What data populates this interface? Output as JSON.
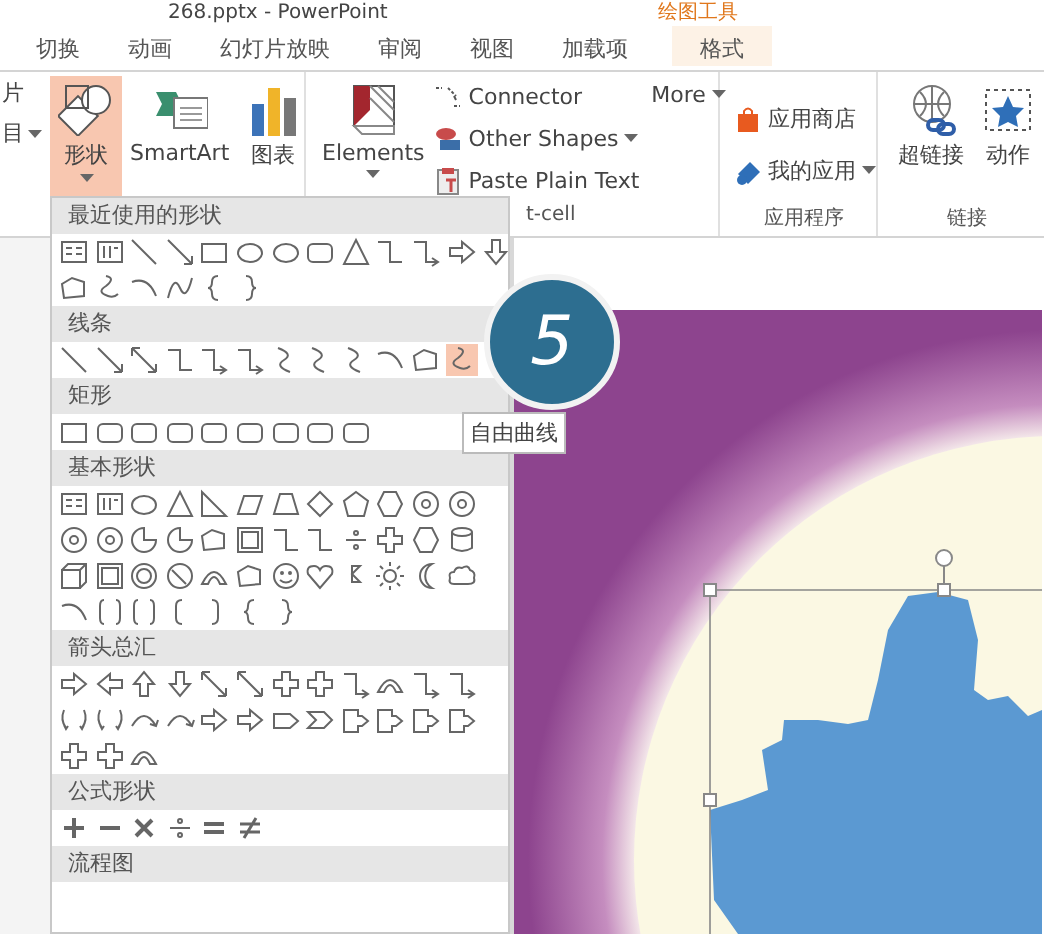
{
  "window": {
    "title": "268.pptx - PowerPoint",
    "context_title": "绘图工具"
  },
  "tabs": [
    {
      "label": "切换",
      "selected": false
    },
    {
      "label": "动画",
      "selected": false
    },
    {
      "label": "幻灯片放映",
      "selected": false
    },
    {
      "label": "审阅",
      "selected": false
    },
    {
      "label": "视图",
      "selected": false
    },
    {
      "label": "加载项",
      "selected": false
    },
    {
      "label": "格式",
      "selected": true
    }
  ],
  "ribbon": {
    "edge_labels": [
      {
        "label": "片",
        "has_menu": false
      },
      {
        "label": "目",
        "has_menu": true
      }
    ],
    "insert_group": {
      "buttons": [
        {
          "kind": "shapes",
          "label": "形状",
          "selected": true,
          "has_menu": true
        },
        {
          "kind": "smartart",
          "label": "SmartArt",
          "selected": false,
          "has_menu": false
        },
        {
          "kind": "chart",
          "label": "图表",
          "selected": false,
          "has_menu": false
        }
      ]
    },
    "addin_group": {
      "elements": {
        "label": "Elements",
        "has_menu": true
      },
      "commands": [
        {
          "kind": "connector",
          "label": "Connector",
          "has_menu": false
        },
        {
          "kind": "shapes",
          "label": "Other Shapes",
          "has_menu": true
        },
        {
          "kind": "paste",
          "label": "Paste Plain Text",
          "has_menu": false
        }
      ],
      "more": {
        "label": "More",
        "has_menu": true
      },
      "group_label": "t-cell"
    },
    "apps_group": {
      "commands": [
        {
          "kind": "store",
          "label": "应用商店",
          "has_menu": false
        },
        {
          "kind": "apps",
          "label": "我的应用",
          "has_menu": true
        }
      ],
      "group_label": "应用程序"
    },
    "links_group": {
      "buttons": [
        {
          "kind": "hyperlink",
          "label": "超链接"
        },
        {
          "kind": "action",
          "label": "动作"
        }
      ],
      "group_label": "链接"
    }
  },
  "shapes_menu": {
    "sections": [
      {
        "title": "最近使用的形状"
      },
      {
        "title": "线条",
        "shapes": [
          {
            "selected": false
          },
          {
            "selected": false
          },
          {
            "selected": false
          },
          {
            "selected": false
          },
          {
            "selected": false
          },
          {
            "selected": false
          },
          {
            "selected": false
          },
          {
            "selected": false
          },
          {
            "selected": false
          },
          {
            "selected": false
          },
          {
            "selected": false
          },
          {
            "selected": true
          }
        ]
      },
      {
        "title": "矩形"
      },
      {
        "title": "基本形状"
      },
      {
        "title": "箭头总汇"
      },
      {
        "title": "公式形状"
      },
      {
        "title": "流程图"
      }
    ],
    "tooltip": "自由曲线"
  },
  "slide": {
    "step_badge": "5"
  }
}
